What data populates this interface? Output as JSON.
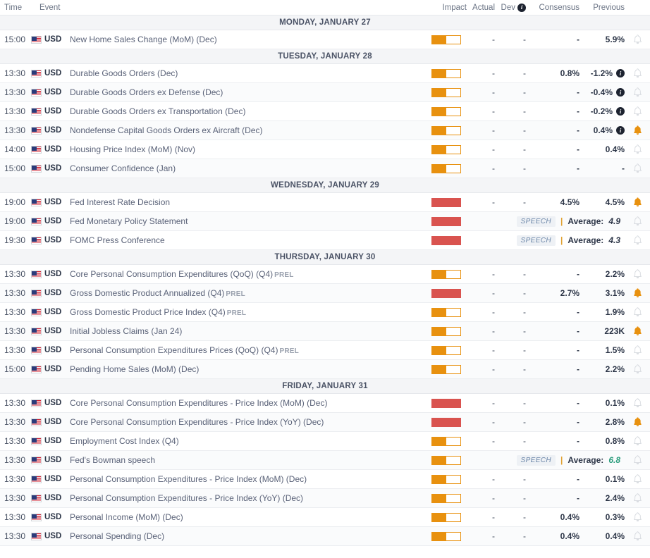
{
  "columns": {
    "time": "Time",
    "event": "Event",
    "impact": "Impact",
    "actual": "Actual",
    "dev": "Dev",
    "dev_info_icon": "info-icon",
    "consensus": "Consensus",
    "previous": "Previous"
  },
  "colors": {
    "impact_medium": "#e8910f",
    "impact_high": "#d9534f",
    "bell_active": "#e8910f",
    "bell_inactive": "#cfd3d9",
    "speech_badge_text": "#6b86a8",
    "avg_green": "#2e9e7e",
    "avg_dark": "#2c3547",
    "prel_label": "#9aa1ae"
  },
  "days": [
    {
      "label": "MONDAY, JANUARY 27",
      "events": [
        {
          "time": "15:00",
          "flag": "us-flag-icon",
          "currency": "USD",
          "name": "New Home Sales Change (MoM) (Dec)",
          "suffix": "",
          "impact": "medium",
          "actual": "-",
          "dev": "-",
          "consensus": "-",
          "previous": "5.9%",
          "info": false,
          "alert": false
        }
      ]
    },
    {
      "label": "TUESDAY, JANUARY 28",
      "events": [
        {
          "time": "13:30",
          "flag": "us-flag-icon",
          "currency": "USD",
          "name": "Durable Goods Orders (Dec)",
          "suffix": "",
          "impact": "medium",
          "actual": "-",
          "dev": "-",
          "consensus": "0.8%",
          "previous": "-1.2%",
          "info": true,
          "alert": false
        },
        {
          "time": "13:30",
          "flag": "us-flag-icon",
          "currency": "USD",
          "name": "Durable Goods Orders ex Defense (Dec)",
          "suffix": "",
          "impact": "medium",
          "actual": "-",
          "dev": "-",
          "consensus": "-",
          "previous": "-0.4%",
          "info": true,
          "alert": false
        },
        {
          "time": "13:30",
          "flag": "us-flag-icon",
          "currency": "USD",
          "name": "Durable Goods Orders ex Transportation (Dec)",
          "suffix": "",
          "impact": "medium",
          "actual": "-",
          "dev": "-",
          "consensus": "-",
          "previous": "-0.2%",
          "info": true,
          "alert": false
        },
        {
          "time": "13:30",
          "flag": "us-flag-icon",
          "currency": "USD",
          "name": "Nondefense Capital Goods Orders ex Aircraft (Dec)",
          "suffix": "",
          "impact": "medium",
          "actual": "-",
          "dev": "-",
          "consensus": "-",
          "previous": "0.4%",
          "info": true,
          "alert": true
        },
        {
          "time": "14:00",
          "flag": "us-flag-icon",
          "currency": "USD",
          "name": "Housing Price Index (MoM) (Nov)",
          "suffix": "",
          "impact": "medium",
          "actual": "-",
          "dev": "-",
          "consensus": "-",
          "previous": "0.4%",
          "info": false,
          "alert": false
        },
        {
          "time": "15:00",
          "flag": "us-flag-icon",
          "currency": "USD",
          "name": "Consumer Confidence (Jan)",
          "suffix": "",
          "impact": "medium",
          "actual": "-",
          "dev": "-",
          "consensus": "-",
          "previous": "-",
          "info": false,
          "alert": false
        }
      ]
    },
    {
      "label": "WEDNESDAY, JANUARY 29",
      "events": [
        {
          "time": "19:00",
          "flag": "us-flag-icon",
          "currency": "USD",
          "name": "Fed Interest Rate Decision",
          "suffix": "",
          "impact": "high",
          "actual": "-",
          "dev": "-",
          "consensus": "4.5%",
          "previous": "4.5%",
          "info": false,
          "alert": true
        },
        {
          "time": "19:00",
          "flag": "us-flag-icon",
          "currency": "USD",
          "name": "Fed Monetary Policy Statement",
          "suffix": "",
          "impact": "high",
          "speech": true,
          "speech_badge": "SPEECH",
          "average_label": "Average:",
          "average_value": "4.9",
          "average_color": "dark",
          "alert": false
        },
        {
          "time": "19:30",
          "flag": "us-flag-icon",
          "currency": "USD",
          "name": "FOMC Press Conference",
          "suffix": "",
          "impact": "high",
          "speech": true,
          "speech_badge": "SPEECH",
          "average_label": "Average:",
          "average_value": "4.3",
          "average_color": "dark",
          "alert": false
        }
      ]
    },
    {
      "label": "THURSDAY, JANUARY 30",
      "events": [
        {
          "time": "13:30",
          "flag": "us-flag-icon",
          "currency": "USD",
          "name": "Core Personal Consumption Expenditures (QoQ) (Q4)",
          "suffix": "PREL",
          "impact": "medium",
          "actual": "-",
          "dev": "-",
          "consensus": "-",
          "previous": "2.2%",
          "info": false,
          "alert": false
        },
        {
          "time": "13:30",
          "flag": "us-flag-icon",
          "currency": "USD",
          "name": "Gross Domestic Product Annualized (Q4)",
          "suffix": "PREL",
          "impact": "high",
          "actual": "-",
          "dev": "-",
          "consensus": "2.7%",
          "previous": "3.1%",
          "info": false,
          "alert": true
        },
        {
          "time": "13:30",
          "flag": "us-flag-icon",
          "currency": "USD",
          "name": "Gross Domestic Product Price Index (Q4)",
          "suffix": "PREL",
          "impact": "medium",
          "actual": "-",
          "dev": "-",
          "consensus": "-",
          "previous": "1.9%",
          "info": false,
          "alert": false
        },
        {
          "time": "13:30",
          "flag": "us-flag-icon",
          "currency": "USD",
          "name": "Initial Jobless Claims (Jan 24)",
          "suffix": "",
          "impact": "medium",
          "actual": "-",
          "dev": "-",
          "consensus": "-",
          "previous": "223K",
          "info": false,
          "alert": true
        },
        {
          "time": "13:30",
          "flag": "us-flag-icon",
          "currency": "USD",
          "name": "Personal Consumption Expenditures Prices (QoQ) (Q4)",
          "suffix": "PREL",
          "impact": "medium",
          "actual": "-",
          "dev": "-",
          "consensus": "-",
          "previous": "1.5%",
          "info": false,
          "alert": false
        },
        {
          "time": "15:00",
          "flag": "us-flag-icon",
          "currency": "USD",
          "name": "Pending Home Sales (MoM) (Dec)",
          "suffix": "",
          "impact": "medium",
          "actual": "-",
          "dev": "-",
          "consensus": "-",
          "previous": "2.2%",
          "info": false,
          "alert": false
        }
      ]
    },
    {
      "label": "FRIDAY, JANUARY 31",
      "events": [
        {
          "time": "13:30",
          "flag": "us-flag-icon",
          "currency": "USD",
          "name": "Core Personal Consumption Expenditures - Price Index (MoM) (Dec)",
          "suffix": "",
          "impact": "high",
          "actual": "-",
          "dev": "-",
          "consensus": "-",
          "previous": "0.1%",
          "info": false,
          "alert": false
        },
        {
          "time": "13:30",
          "flag": "us-flag-icon",
          "currency": "USD",
          "name": "Core Personal Consumption Expenditures - Price Index (YoY) (Dec)",
          "suffix": "",
          "impact": "high",
          "actual": "-",
          "dev": "-",
          "consensus": "-",
          "previous": "2.8%",
          "info": false,
          "alert": true
        },
        {
          "time": "13:30",
          "flag": "us-flag-icon",
          "currency": "USD",
          "name": "Employment Cost Index (Q4)",
          "suffix": "",
          "impact": "medium",
          "actual": "-",
          "dev": "-",
          "consensus": "-",
          "previous": "0.8%",
          "info": false,
          "alert": false
        },
        {
          "time": "13:30",
          "flag": "us-flag-icon",
          "currency": "USD",
          "name": "Fed's Bowman speech",
          "suffix": "",
          "impact": "medium",
          "speech": true,
          "speech_badge": "SPEECH",
          "average_label": "Average:",
          "average_value": "6.8",
          "average_color": "green",
          "alert": false
        },
        {
          "time": "13:30",
          "flag": "us-flag-icon",
          "currency": "USD",
          "name": "Personal Consumption Expenditures - Price Index (MoM) (Dec)",
          "suffix": "",
          "impact": "medium",
          "actual": "-",
          "dev": "-",
          "consensus": "-",
          "previous": "0.1%",
          "info": false,
          "alert": false
        },
        {
          "time": "13:30",
          "flag": "us-flag-icon",
          "currency": "USD",
          "name": "Personal Consumption Expenditures - Price Index (YoY) (Dec)",
          "suffix": "",
          "impact": "medium",
          "actual": "-",
          "dev": "-",
          "consensus": "-",
          "previous": "2.4%",
          "info": false,
          "alert": false
        },
        {
          "time": "13:30",
          "flag": "us-flag-icon",
          "currency": "USD",
          "name": "Personal Income (MoM) (Dec)",
          "suffix": "",
          "impact": "medium",
          "actual": "-",
          "dev": "-",
          "consensus": "0.4%",
          "previous": "0.3%",
          "info": false,
          "alert": false
        },
        {
          "time": "13:30",
          "flag": "us-flag-icon",
          "currency": "USD",
          "name": "Personal Spending (Dec)",
          "suffix": "",
          "impact": "medium",
          "actual": "-",
          "dev": "-",
          "consensus": "0.4%",
          "previous": "0.4%",
          "info": false,
          "alert": false
        }
      ]
    }
  ]
}
